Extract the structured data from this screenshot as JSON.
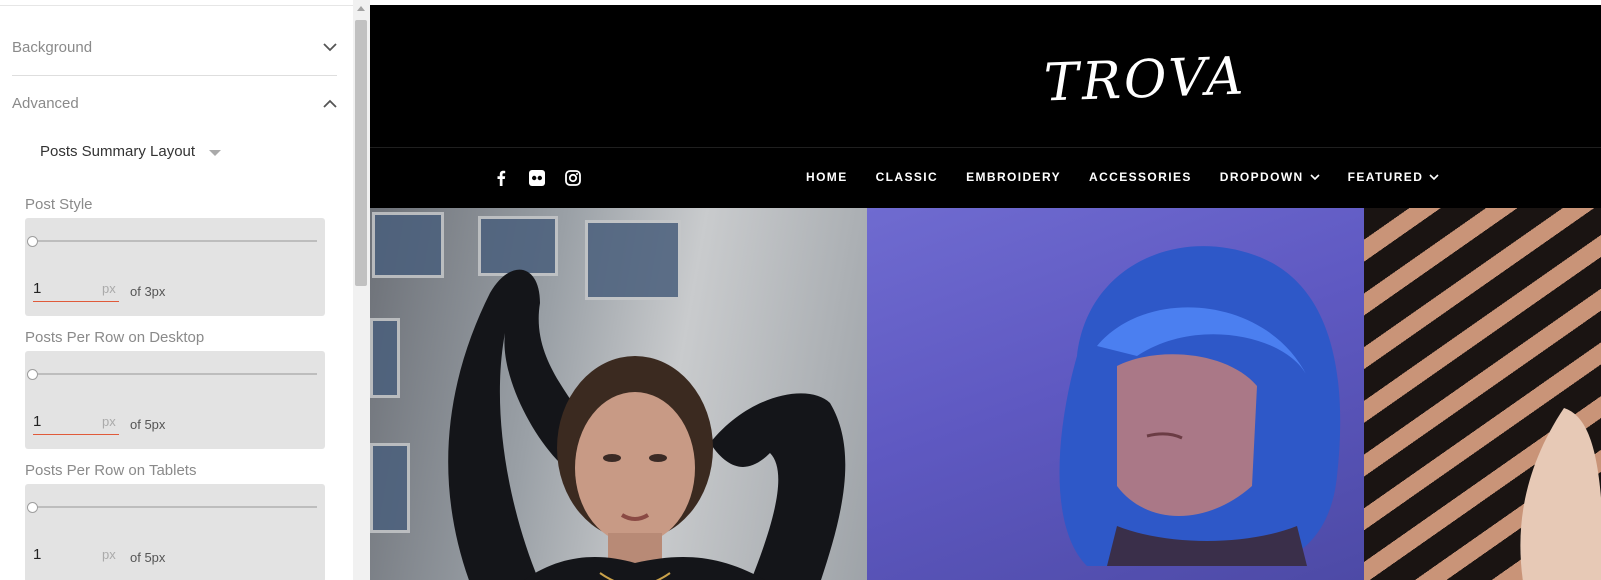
{
  "panel": {
    "sections": [
      {
        "label": "Background",
        "expanded": false
      },
      {
        "label": "Advanced",
        "expanded": true
      }
    ],
    "layout_select": {
      "label": "Posts Summary Layout"
    },
    "fields": [
      {
        "label": "Post Style",
        "value": "1",
        "unit": "px",
        "max_text": "of 3px",
        "level": 0
      },
      {
        "label": "Posts Per Row on Desktop",
        "value": "1",
        "unit": "px",
        "max_text": "of 5px",
        "level": 0
      },
      {
        "label": "Posts Per Row on Tablets",
        "value": "1",
        "unit": "px",
        "max_text": "of 5px",
        "level": 0
      }
    ]
  },
  "site": {
    "logo": "TROVA",
    "social_icons": [
      "facebook-icon",
      "flickr-icon",
      "instagram-icon"
    ],
    "nav": [
      {
        "label": "HOME",
        "dropdown": false
      },
      {
        "label": "CLASSIC",
        "dropdown": false
      },
      {
        "label": "EMBROIDERY",
        "dropdown": false
      },
      {
        "label": "ACCESSORIES",
        "dropdown": false
      },
      {
        "label": "DROPDOWN",
        "dropdown": true
      },
      {
        "label": "FEATURED",
        "dropdown": true
      }
    ]
  },
  "colors": {
    "accent_underline": "#e05a3a",
    "site_background": "#000000",
    "panel_field_bg": "#e3e3e3"
  }
}
